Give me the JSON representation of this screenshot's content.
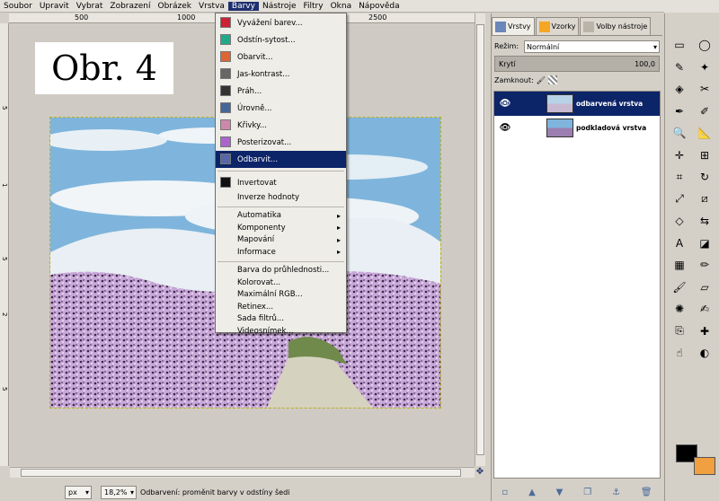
{
  "menubar": {
    "items": [
      {
        "label": "Soubor",
        "open": false
      },
      {
        "label": "Upravit",
        "open": false
      },
      {
        "label": "Vybrat",
        "open": false
      },
      {
        "label": "Zobrazení",
        "open": false
      },
      {
        "label": "Obrázek",
        "open": false
      },
      {
        "label": "Vrstva",
        "open": false
      },
      {
        "label": "Barvy",
        "open": true
      },
      {
        "label": "Nástroje",
        "open": false
      },
      {
        "label": "Filtry",
        "open": false
      },
      {
        "label": "Okna",
        "open": false
      },
      {
        "label": "Nápověda",
        "open": false
      }
    ]
  },
  "ruler": {
    "top_labels": [
      "500",
      "1000",
      "2500"
    ],
    "left_labels": [
      "5",
      "1",
      "5",
      "2",
      "5"
    ]
  },
  "canvas": {
    "label_text": "Obr. 4"
  },
  "colors_menu": {
    "items": [
      {
        "label": "Vyvážení barev...",
        "icon": "color-balance-icon",
        "selected": false,
        "submenu": false
      },
      {
        "label": "Odstín-sytost...",
        "icon": "hue-saturation-icon",
        "selected": false,
        "submenu": false
      },
      {
        "label": "Obarvit...",
        "icon": "colorize-icon",
        "selected": false,
        "submenu": false
      },
      {
        "label": "Jas-kontrast...",
        "icon": "brightness-contrast-icon",
        "selected": false,
        "submenu": false
      },
      {
        "label": "Práh...",
        "icon": "threshold-icon",
        "selected": false,
        "submenu": false
      },
      {
        "label": "Úrovně...",
        "icon": "levels-icon",
        "selected": false,
        "submenu": false
      },
      {
        "label": "Křivky...",
        "icon": "curves-icon",
        "selected": false,
        "submenu": false
      },
      {
        "label": "Posterizovat...",
        "icon": "posterize-icon",
        "selected": false,
        "submenu": false
      },
      {
        "label": "Odbarvit...",
        "icon": "desaturate-icon",
        "selected": true,
        "submenu": false
      }
    ],
    "group2": [
      {
        "label": "Invertovat",
        "icon": "invert-icon"
      },
      {
        "label": "Inverze hodnoty",
        "icon": ""
      }
    ],
    "group3": [
      {
        "label": "Automatika",
        "submenu": true
      },
      {
        "label": "Komponenty",
        "submenu": true
      },
      {
        "label": "Mapování",
        "submenu": true
      },
      {
        "label": "Informace",
        "submenu": true
      }
    ],
    "group4": [
      {
        "label": "Barva do průhlednosti..."
      },
      {
        "label": "Kolorovat..."
      },
      {
        "label": "Maximální RGB..."
      },
      {
        "label": "Retinex..."
      },
      {
        "label": "Sada filtrů..."
      },
      {
        "label": "Videosnímek..."
      }
    ]
  },
  "statusbar": {
    "unit": "px",
    "zoom": "18,2%",
    "message": "Odbarvení: proměnit barvy v odstíny šedi"
  },
  "layers_panel": {
    "tabs": [
      "Vrstvy",
      "Vzorky",
      "Volby nástroje"
    ],
    "mode_label": "Režim:",
    "mode_value": "Normální",
    "opacity_label": "Krytí",
    "opacity_value": "100,0",
    "lock_label": "Zamknout:",
    "layers": [
      {
        "name": "odbarvená vrstva",
        "selected": true
      },
      {
        "name": "podkladová vrstva",
        "selected": false
      }
    ]
  },
  "toolbox": {
    "tools": [
      "rect-select",
      "ellipse-select",
      "free-select",
      "fuzzy-select",
      "color-select",
      "scissors-select",
      "paths",
      "color-picker",
      "zoom",
      "measure",
      "move",
      "align",
      "crop",
      "rotate",
      "scale",
      "shear",
      "perspective",
      "flip",
      "text",
      "bucket-fill",
      "blend",
      "pencil",
      "paintbrush",
      "eraser",
      "airbrush",
      "ink",
      "clone",
      "heal",
      "smudge",
      "dodge-burn"
    ],
    "fg_color": "#000000",
    "bg_color": "#f0a040"
  }
}
